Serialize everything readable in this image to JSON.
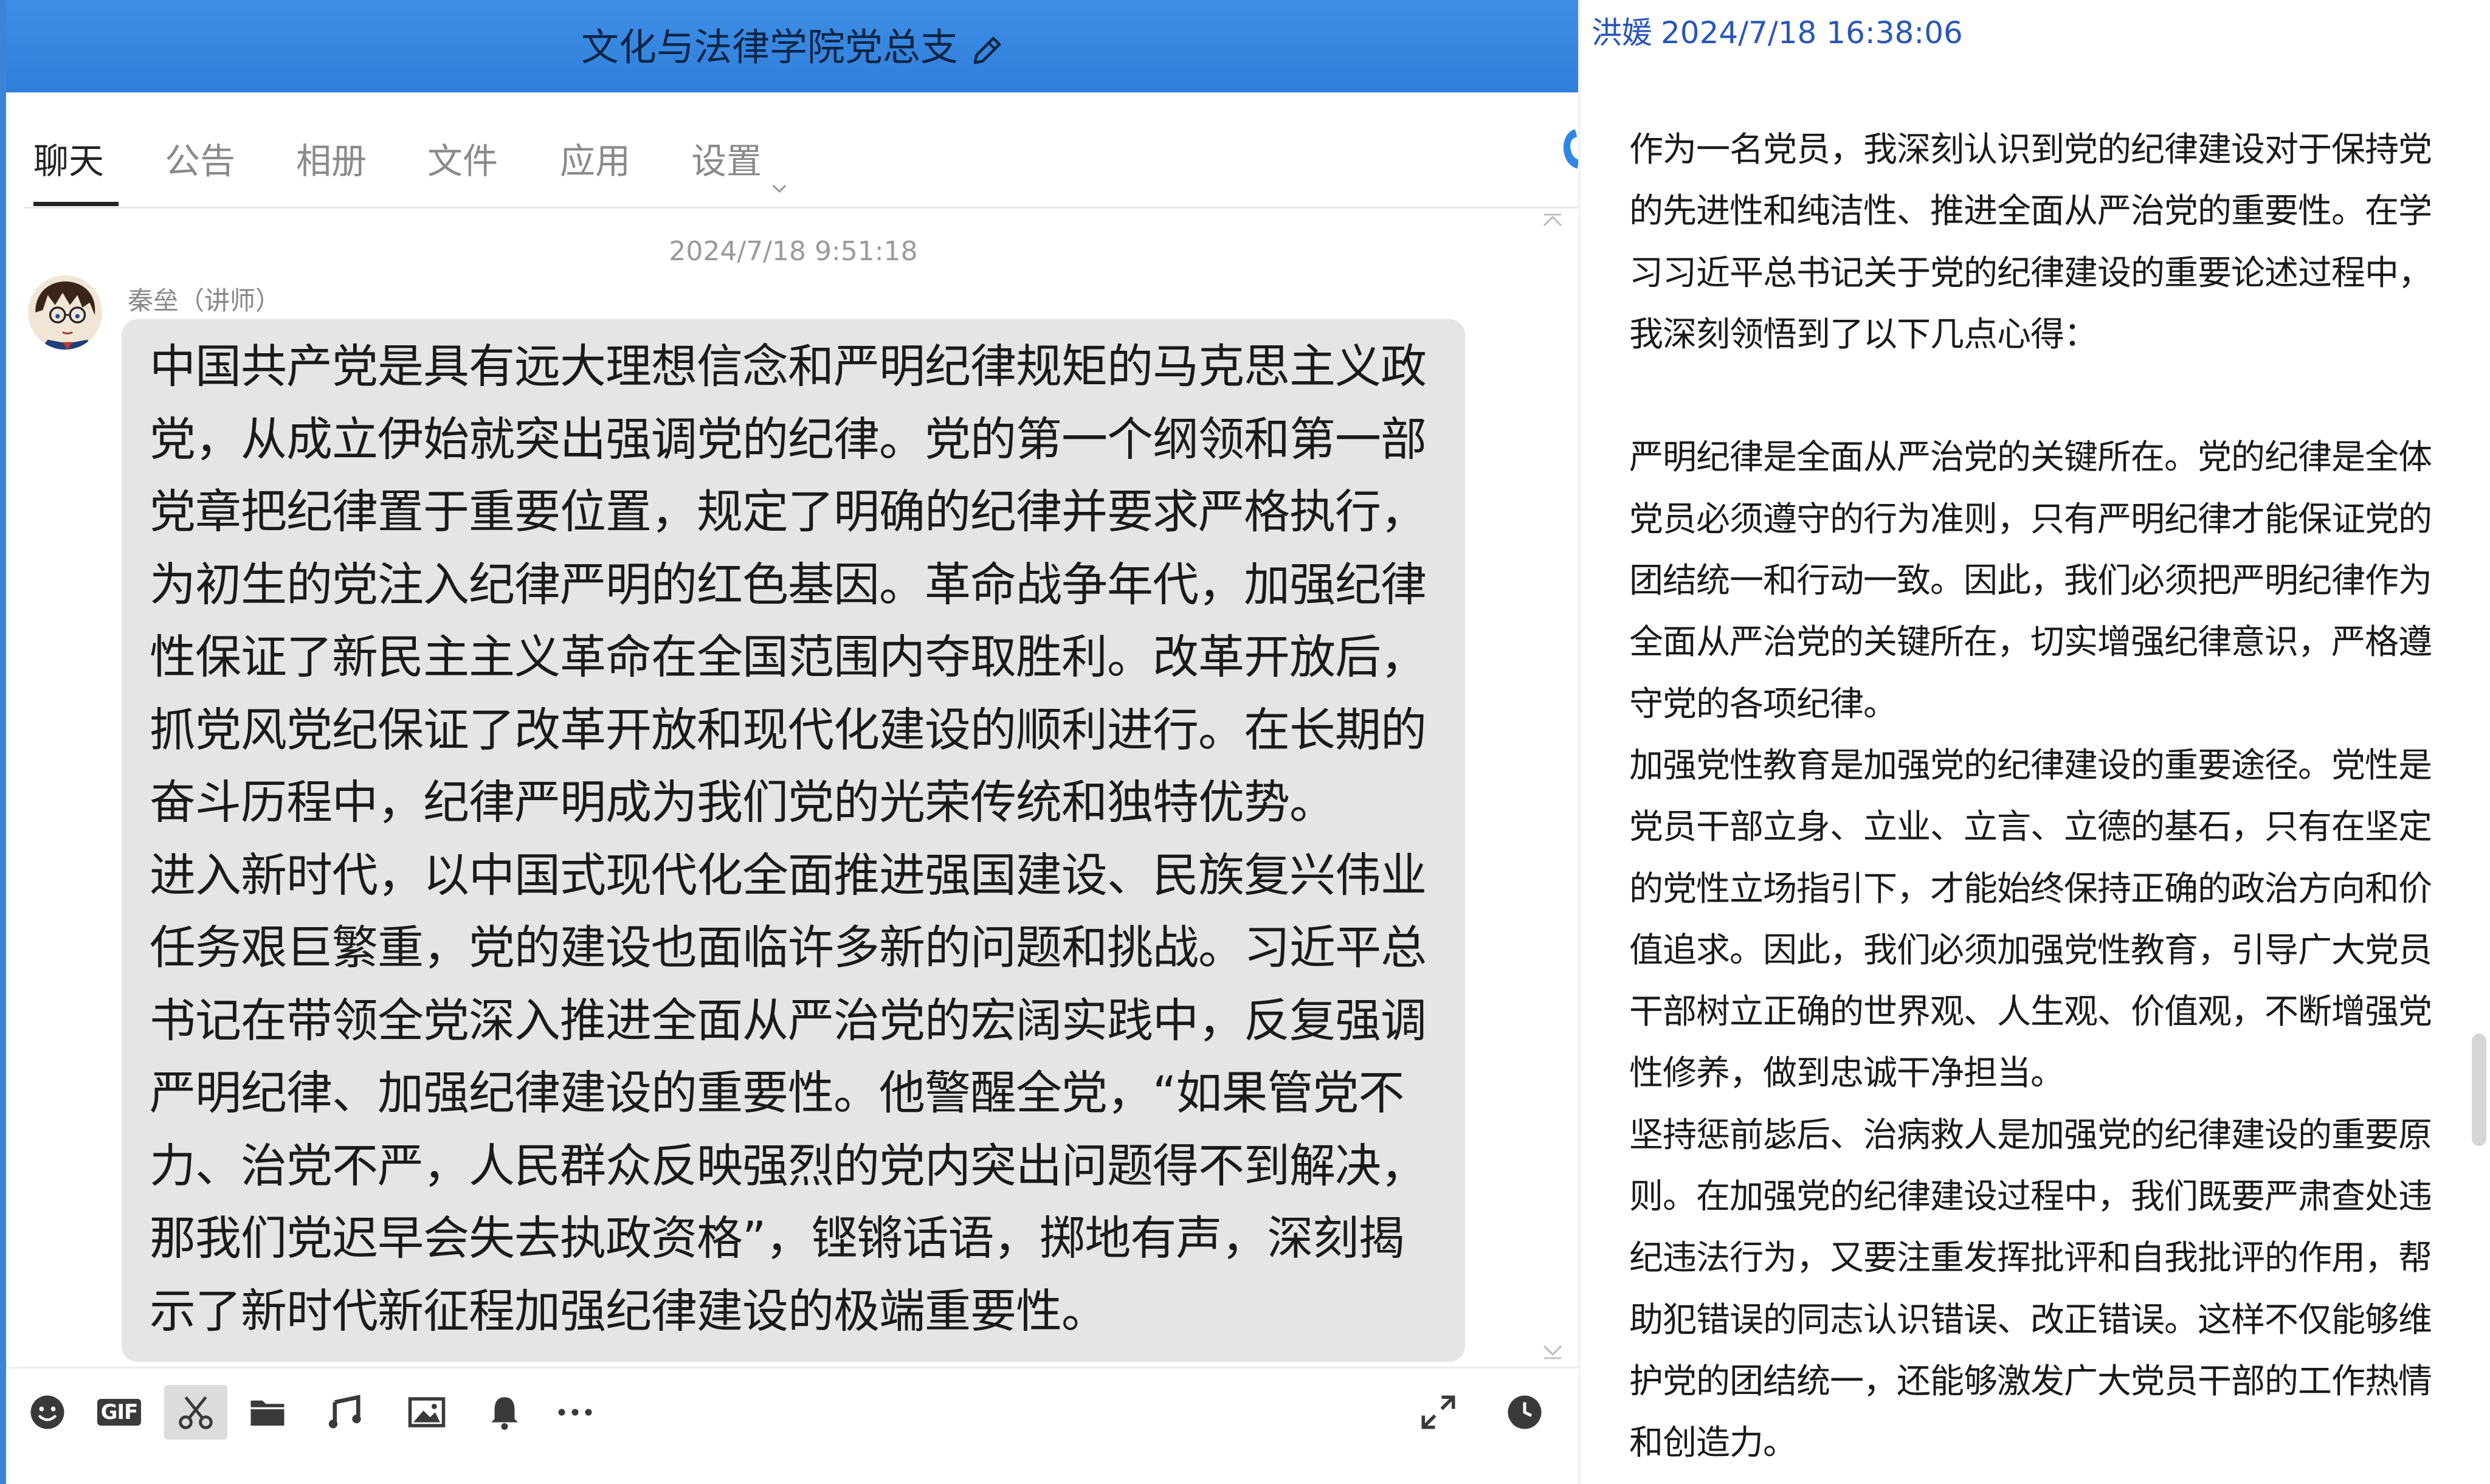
{
  "chat_window": {
    "title": "文化与法律学院党总支",
    "tabs": [
      {
        "label": "聊天"
      },
      {
        "label": "公告"
      },
      {
        "label": "相册"
      },
      {
        "label": "文件"
      },
      {
        "label": "应用"
      },
      {
        "label": "设置"
      }
    ],
    "message": {
      "time": "2024/7/18 9:51:18",
      "sender": "秦垒（讲师）",
      "paragraphs": [
        "中国共产党是具有远大理想信念和严明纪律规矩的马克思主义政党，从成立伊始就突出强调党的纪律。党的第一个纲领和第一部党章把纪律置于重要位置，规定了明确的纪律并要求严格执行，为初生的党注入纪律严明的红色基因。革命战争年代，加强纪律性保证了新民主主义革命在全国范围内夺取胜利。改革开放后，抓党风党纪保证了改革开放和现代化建设的顺利进行。在长期的奋斗历程中，纪律严明成为我们党的光荣传统和独特优势。",
        "进入新时代，以中国式现代化全面推进强国建设、民族复兴伟业任务艰巨繁重，党的建设也面临许多新的问题和挑战。习近平总书记在带领全党深入推进全面从严治党的宏阔实践中，反复强调严明纪律、加强纪律建设的重要性。他警醒全党，“如果管党不力、治党不严，人民群众反映强烈的党内突出问题得不到解决，那我们党迟早会失去执政资格”，铿锵话语，掷地有声，深刻揭示了新时代新征程加强纪律建设的极端重要性。"
      ]
    },
    "toolbar_icons": [
      "emoji-icon",
      "gif-icon",
      "scissors-icon",
      "folder-icon",
      "music-icon",
      "image-icon",
      "bell-icon",
      "more-icon",
      "expand-icon",
      "history-clock-icon"
    ],
    "gif_label": "GIF"
  },
  "right_panel": {
    "sender": "洪媛",
    "time": "2024/7/18 16:38:06",
    "paragraphs": [
      "作为一名党员，我深刻认识到党的纪律建设对于保持党的先进性和纯洁性、推进全面从严治党的重要性。在学习习近平总书记关于党的纪律建设的重要论述过程中，我深刻领悟到了以下几点心得：",
      "",
      "严明纪律是全面从严治党的关键所在。党的纪律是全体党员必须遵守的行为准则，只有严明纪律才能保证党的团结统一和行动一致。因此，我们必须把严明纪律作为全面从严治党的关键所在，切实增强纪律意识，严格遵守党的各项纪律。",
      "加强党性教育是加强党的纪律建设的重要途径。党性是党员干部立身、立业、立言、立德的基石，只有在坚定的党性立场指引下，才能始终保持正确的政治方向和价值追求。因此，我们必须加强党性教育，引导广大党员干部树立正确的世界观、人生观、价值观，不断增强党性修养，做到忠诚干净担当。",
      "坚持惩前毖后、治病救人是加强党的纪律建设的重要原则。在加强党的纪律建设过程中，我们既要严肃查处违纪违法行为，又要注重发挥批评和自我批评的作用，帮助犯错误的同志认识错误、改正错误。这样不仅能够维护党的团结统一，还能够激发广大党员干部的工作热情和创造力。"
    ]
  },
  "colors": {
    "title_bar": "#2f7fdb",
    "bubble": "#e5e5e5",
    "right_header": "#2a56b8"
  }
}
